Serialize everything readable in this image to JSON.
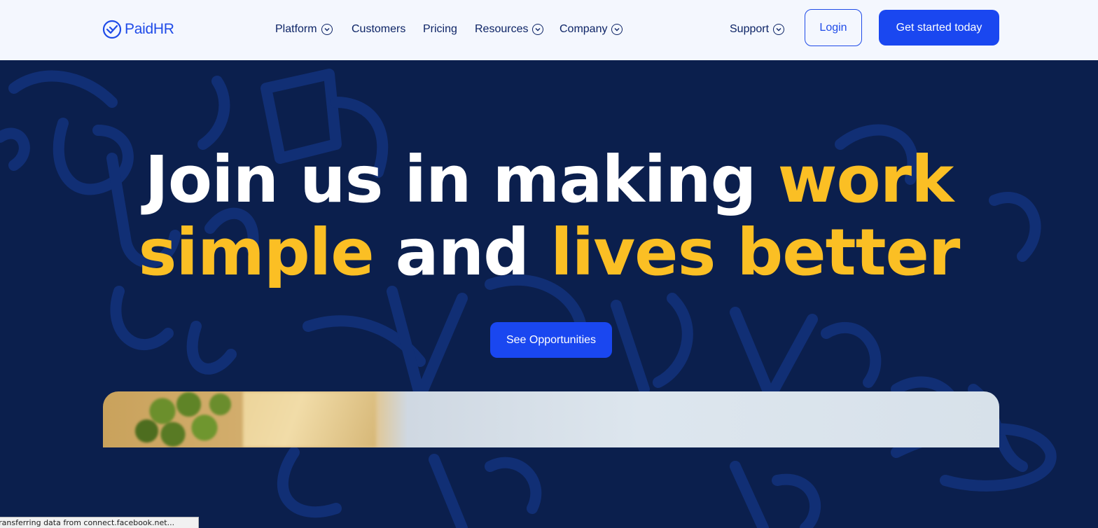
{
  "header": {
    "logo": {
      "text": "PaidHR",
      "icon": "paidhr-check-logo-icon"
    },
    "nav": [
      {
        "label": "Platform",
        "has_dropdown": true
      },
      {
        "label": "Customers",
        "has_dropdown": false
      },
      {
        "label": "Pricing",
        "has_dropdown": false
      },
      {
        "label": "Resources",
        "has_dropdown": true
      },
      {
        "label": "Company",
        "has_dropdown": true
      }
    ],
    "support": {
      "label": "Support",
      "has_dropdown": true
    },
    "login_label": "Login",
    "cta_label": "Get started today"
  },
  "hero": {
    "headline": {
      "part1": "Join us in making ",
      "part2": "work",
      "part3": "simple",
      "part4": " and ",
      "part5": "lives better"
    },
    "button_label": "See Opportunities"
  },
  "status_bar": {
    "text": "Transferring data from connect.facebook.net..."
  },
  "colors": {
    "brand_blue": "#1a47f0",
    "hero_bg": "#0b1f4d",
    "header_bg": "#f4f7fe",
    "accent_yellow": "#fbbf24",
    "nav_text": "#0d2466"
  }
}
